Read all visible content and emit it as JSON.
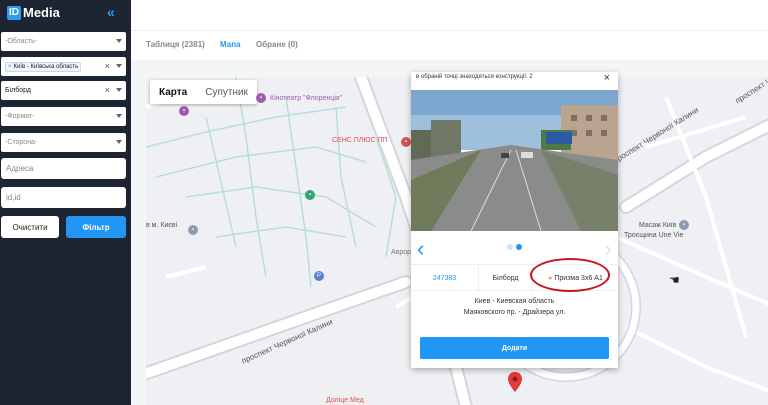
{
  "sidebar": {
    "logo_id": "ID",
    "logo_text": "Media",
    "region_placeholder": "-Область-",
    "city_tag": "Київ - Київська область",
    "type_value": "Білборд",
    "format_placeholder": "-Формат-",
    "side_placeholder": "-Сторона-",
    "address_placeholder": "Адреса",
    "id_placeholder": "id,id",
    "clear_label": "Очистити",
    "filter_label": "Фільтр"
  },
  "tabs": [
    {
      "label": "Таблиця (2381)"
    },
    {
      "label": "Мапа"
    },
    {
      "label": "Обране (0)"
    }
  ],
  "map": {
    "map_label": "Карта",
    "satellite_label": "Супутник",
    "poi": [
      {
        "label": "Кінотеатр \"Флоренція\""
      },
      {
        "label": "СЕНС ПЛЮС ПП"
      },
      {
        "label": "Масаж Київ"
      },
      {
        "label": "Троєщина Une Vie"
      },
      {
        "label": "в м. Києві"
      },
      {
        "label": "Аврора"
      },
      {
        "label": "Доліце Мед"
      }
    ],
    "streets": [
      {
        "label": "проспект Червоної Калини"
      },
      {
        "label": "проспект Червоної Калини"
      },
      {
        "label": "проспект Червоної Калини"
      }
    ]
  },
  "popup": {
    "note": "в обраній точці знаходяться конструкції: 2",
    "id": "247383",
    "type": "Білборд",
    "format": "Призма 3x6 А1",
    "address_line1": "Киев - Киевская область",
    "address_line2": "Маяковского пр. - Драйзера ул.",
    "add_label": "Додати"
  },
  "colors": {
    "accent": "#2196f3",
    "sidebar_bg": "#1d2432",
    "highlight": "#c8151b"
  }
}
